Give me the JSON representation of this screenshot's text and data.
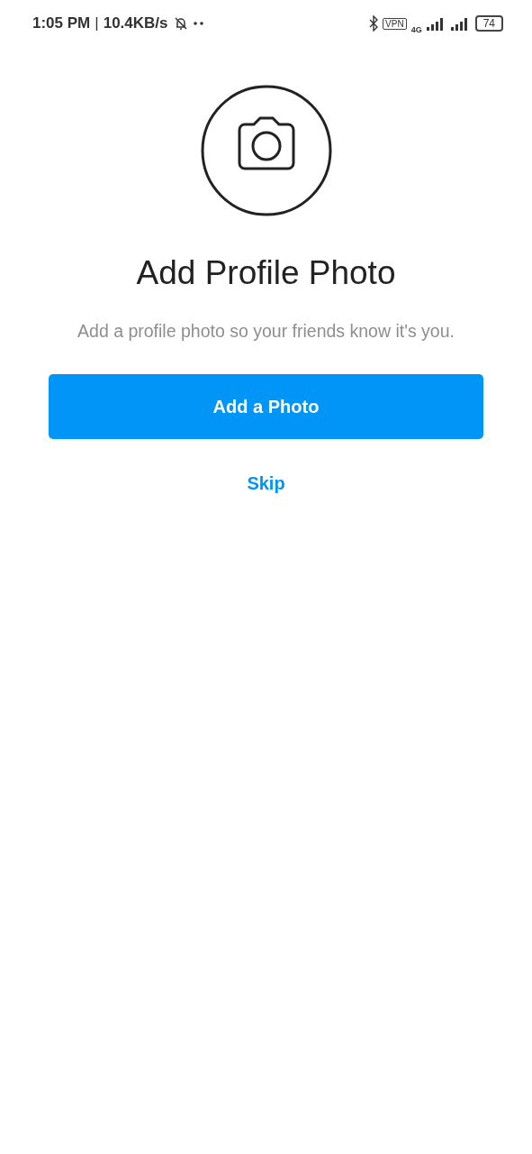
{
  "status_bar": {
    "time": "1:05 PM",
    "separator": "|",
    "network_speed": "10.4KB/s",
    "vpn": "VPN",
    "network_type": "4G",
    "battery": "74"
  },
  "title": "Add Profile Photo",
  "subtitle": "Add a profile photo so your friends know it's you.",
  "primary_button": "Add a Photo",
  "skip_link": "Skip"
}
